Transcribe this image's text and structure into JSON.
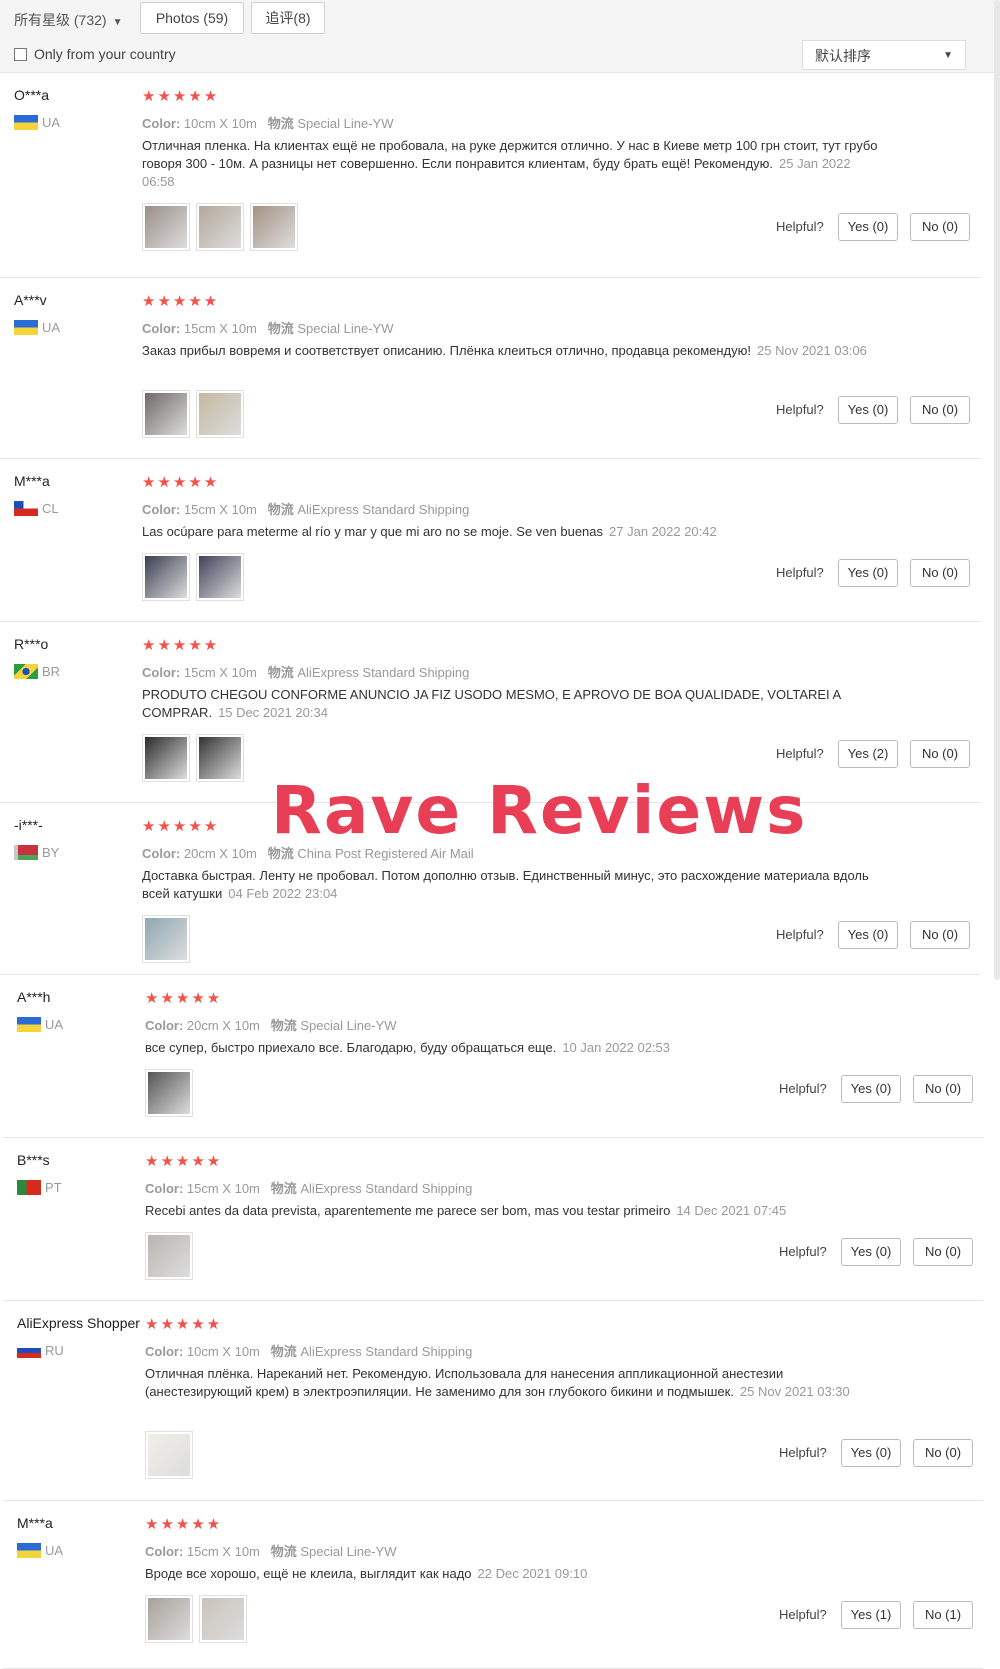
{
  "filters": {
    "rating": "所有星级 (732)",
    "photos_tab": "Photos (59)",
    "followup_tab": "追评(8)",
    "only_country": "Only from your country",
    "sort": "默认排序"
  },
  "overlay_text": "Rave Reviews",
  "helpful_label": "Helpful?",
  "reviews": [
    {
      "user": "O***a",
      "country": "UA",
      "color_label": "Color:",
      "color": "10cm X 10m",
      "ship_label": "物流",
      "shipping": "Special Line-YW",
      "text": "Отличная пленка. На клиентах ещё не пробовала, на руке держится отлично. У нас в Киеве метр 100 грн стоит, тут грубо говоря 300 - 10м. А разницы нет совершенно. Если понравится клиентам, буду брать ещё! Рекомендую.",
      "date": "25 Jan 2022 06:58",
      "yes": "Yes (0)",
      "no": "No (0)"
    },
    {
      "user": "A***v",
      "country": "UA",
      "color_label": "Color:",
      "color": "15cm X 10m",
      "ship_label": "物流",
      "shipping": "Special Line-YW",
      "text": "Заказ прибыл вовремя и соответствует описанию. Плёнка клеиться отлично, продавца рекомендую!",
      "date": "25 Nov 2021 03:06",
      "yes": "Yes (0)",
      "no": "No (0)"
    },
    {
      "user": "M***a",
      "country": "CL",
      "color_label": "Color:",
      "color": "15cm X 10m",
      "ship_label": "物流",
      "shipping": "AliExpress Standard Shipping",
      "text": "Las ocúpare para meterme al río y mar y que mi aro no se moje. Se ven buenas",
      "date": "27 Jan 2022 20:42",
      "yes": "Yes (0)",
      "no": "No (0)"
    },
    {
      "user": "R***o",
      "country": "BR",
      "color_label": "Color:",
      "color": "15cm X 10m",
      "ship_label": "物流",
      "shipping": "AliExpress Standard Shipping",
      "text": "PRODUTO CHEGOU CONFORME ANUNCIO JA FIZ USODO MESMO, E APROVO DE BOA QUALIDADE, VOLTAREI A COMPRAR.",
      "date": "15 Dec 2021 20:34",
      "yes": "Yes (2)",
      "no": "No (0)"
    },
    {
      "user": "-i***-",
      "country": "BY",
      "color_label": "Color:",
      "color": "20cm X 10m",
      "ship_label": "物流",
      "shipping": "China Post Registered Air Mail",
      "text": "Доставка быстрая. Ленту не пробовал. Потом дополню отзыв. Единственный минус, это расхождение материала вдоль всей катушки",
      "date": "04 Feb 2022 23:04",
      "yes": "Yes (0)",
      "no": "No (0)"
    },
    {
      "user": "A***h",
      "country": "UA",
      "color_label": "Color:",
      "color": "20cm X 10m",
      "ship_label": "物流",
      "shipping": "Special Line-YW",
      "text": "все супер, быстро приехало все. Благодарю, буду обращаться еще.",
      "date": "10 Jan 2022 02:53",
      "yes": "Yes (0)",
      "no": "No (0)"
    },
    {
      "user": "B***s",
      "country": "PT",
      "color_label": "Color:",
      "color": "15cm X 10m",
      "ship_label": "物流",
      "shipping": "AliExpress Standard Shipping",
      "text": "Recebi antes da data prevista, aparentemente me parece ser bom, mas vou testar primeiro",
      "date": "14 Dec 2021 07:45",
      "yes": "Yes (0)",
      "no": "No (0)"
    },
    {
      "user": "AliExpress Shopper",
      "country": "RU",
      "color_label": "Color:",
      "color": "10cm X 10m",
      "ship_label": "物流",
      "shipping": "AliExpress Standard Shipping",
      "text": "Отличная плёнка. Нареканий нет. Рекомендую. Использовала для нанесения аппликационной анестезии (анестезирующий крем) в электроэпиляции. Не заменимо для зон глубокого бикини и подмышек.",
      "date": "25 Nov 2021 03:30",
      "yes": "Yes (0)",
      "no": "No (0)"
    },
    {
      "user": "M***a",
      "country": "UA",
      "color_label": "Color:",
      "color": "15cm X 10m",
      "ship_label": "物流",
      "shipping": "Special Line-YW",
      "text": "Вроде все хорошо, ещё не клеила, выглядит как надо",
      "date": "22 Dec 2021 09:10",
      "yes": "Yes (1)",
      "no": "No (1)"
    }
  ]
}
